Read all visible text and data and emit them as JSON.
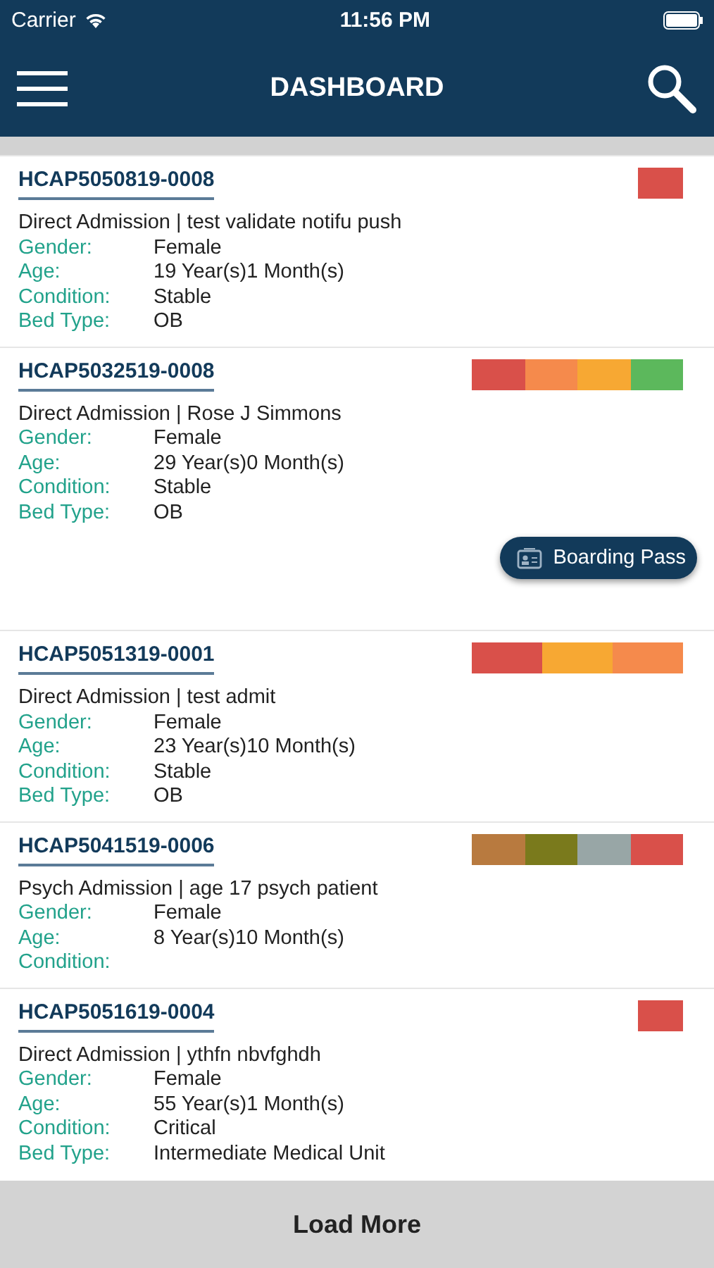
{
  "status_bar": {
    "carrier": "Carrier",
    "time": "11:56 PM"
  },
  "header": {
    "title": "DASHBOARD"
  },
  "patients": [
    {
      "id": "HCAP5050819-0008",
      "summary": "Direct Admission | test validate notifu push",
      "flags": [
        {
          "color": "#d9504a"
        }
      ],
      "fields": [
        {
          "label": "Gender:",
          "value": "Female"
        },
        {
          "label": "Age:",
          "value": "19 Year(s)1 Month(s)"
        },
        {
          "label": "Condition:",
          "value": "Stable"
        },
        {
          "label": "Bed Type:",
          "value": "OB"
        }
      ]
    },
    {
      "id": "HCAP5032519-0008",
      "summary": "Direct Admission | Rose J Simmons",
      "flags": [
        {
          "color": "#d9504a"
        },
        {
          "color": "#f58a4c"
        },
        {
          "color": "#f7a833"
        },
        {
          "color": "#5cb85c"
        }
      ],
      "fields": [
        {
          "label": "Gender:",
          "value": "Female"
        },
        {
          "label": "Age:",
          "value": "29 Year(s)0 Month(s)"
        },
        {
          "label": "Condition:",
          "value": "Stable"
        },
        {
          "label": "Bed Type:",
          "value": "OB"
        }
      ],
      "action": "Boarding Pass"
    },
    {
      "id": "HCAP5051319-0001",
      "summary": "Direct Admission | test admit",
      "flags": [
        {
          "color": "#d9504a"
        },
        {
          "color": "#f7a833"
        },
        {
          "color": "#f58a4c"
        }
      ],
      "fields": [
        {
          "label": "Gender:",
          "value": "Female"
        },
        {
          "label": "Age:",
          "value": "23 Year(s)10 Month(s)"
        },
        {
          "label": "Condition:",
          "value": "Stable"
        },
        {
          "label": "Bed Type:",
          "value": "OB"
        }
      ]
    },
    {
      "id": "HCAP5041519-0006",
      "summary": "Psych Admission | age 17 psych patient",
      "flags": [
        {
          "color": "#b87a3f"
        },
        {
          "color": "#7a7a1c"
        },
        {
          "color": "#98a6a6"
        },
        {
          "color": "#d9504a"
        }
      ],
      "fields": [
        {
          "label": "Gender:",
          "value": "Female"
        },
        {
          "label": "Age:",
          "value": "8 Year(s)10 Month(s)"
        },
        {
          "label": "Condition:"
        }
      ]
    },
    {
      "id": "HCAP5051619-0004",
      "summary": "Direct Admission | ythfn nbvfghdh",
      "flags": [
        {
          "color": "#d9504a"
        }
      ],
      "fields": [
        {
          "label": "Gender:",
          "value": "Female"
        },
        {
          "label": "Age:",
          "value": "55 Year(s)1 Month(s)"
        },
        {
          "label": "Condition:",
          "value": "Critical"
        },
        {
          "label": "Bed Type:",
          "value": "Intermediate Medical Unit"
        }
      ]
    }
  ],
  "load_more": "Load More"
}
